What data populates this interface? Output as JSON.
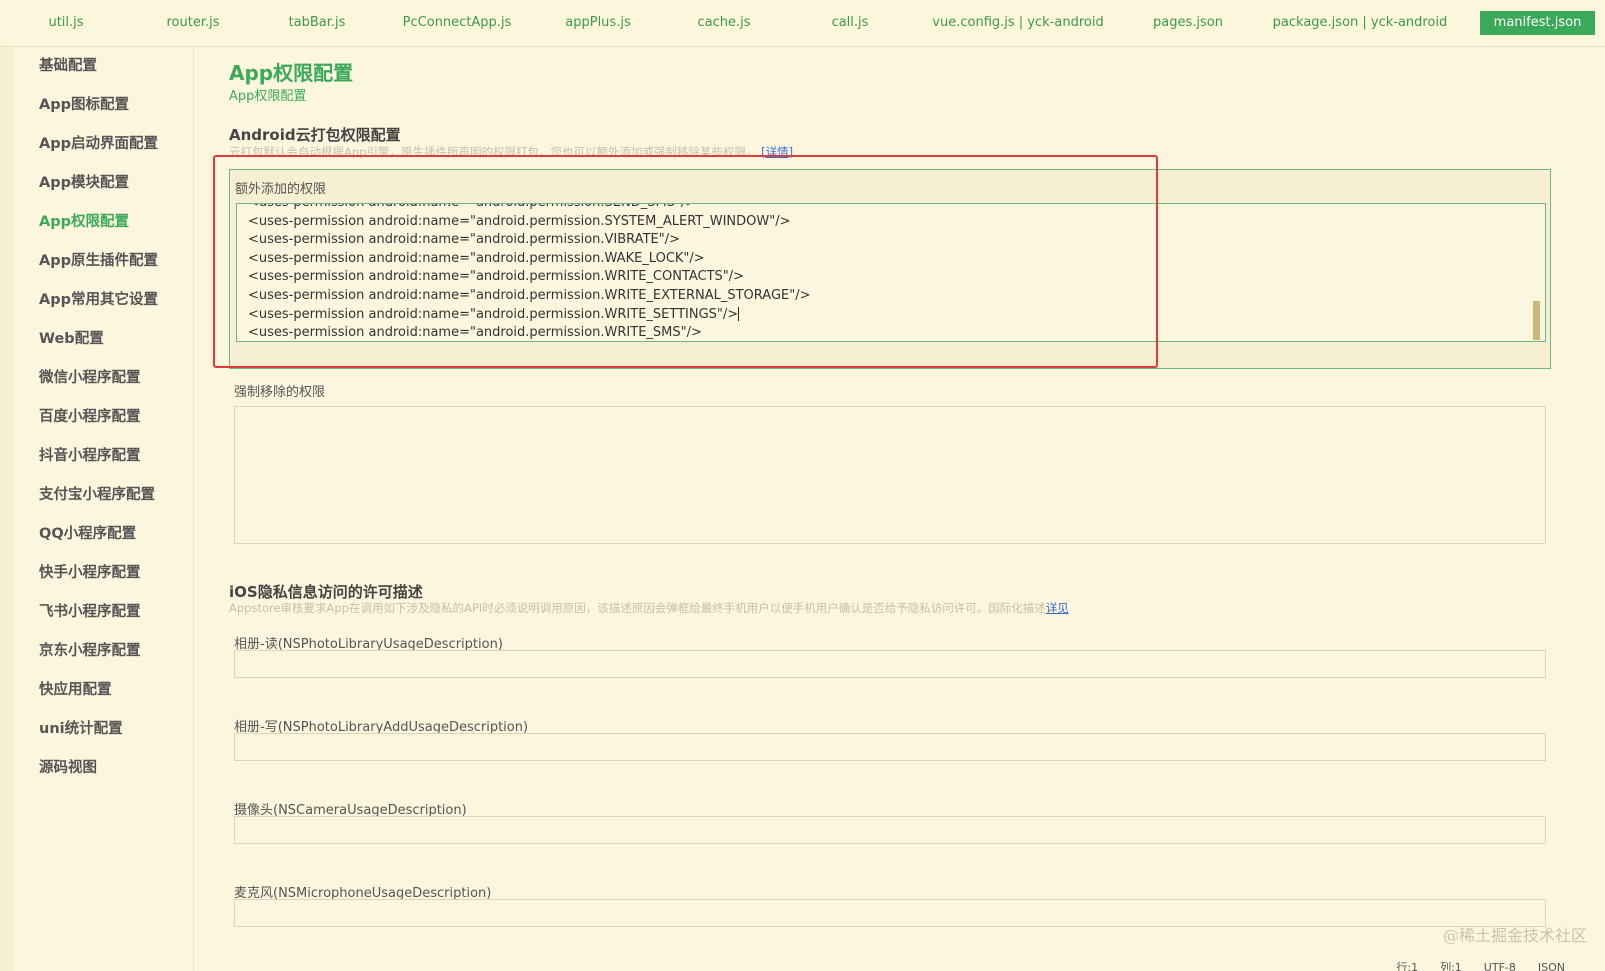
{
  "tabs": [
    {
      "label": "util.js",
      "active": false
    },
    {
      "label": "router.js",
      "active": false
    },
    {
      "label": "tabBar.js",
      "active": false
    },
    {
      "label": "PcConnectApp.js",
      "active": false
    },
    {
      "label": "appPlus.js",
      "active": false
    },
    {
      "label": "cache.js",
      "active": false
    },
    {
      "label": "call.js",
      "active": false
    },
    {
      "label": "vue.config.js | yck-android",
      "active": false
    },
    {
      "label": "pages.json",
      "active": false
    },
    {
      "label": "package.json | yck-android",
      "active": false
    },
    {
      "label": "manifest.json",
      "active": true
    }
  ],
  "sidebar": {
    "items": [
      {
        "label": "基础配置"
      },
      {
        "label": "App图标配置"
      },
      {
        "label": "App启动界面配置"
      },
      {
        "label": "App模块配置"
      },
      {
        "label": "App权限配置",
        "active": true
      },
      {
        "label": "App原生插件配置"
      },
      {
        "label": "App常用其它设置"
      },
      {
        "label": "Web配置"
      },
      {
        "label": "微信小程序配置"
      },
      {
        "label": "百度小程序配置"
      },
      {
        "label": "抖音小程序配置"
      },
      {
        "label": "支付宝小程序配置"
      },
      {
        "label": "QQ小程序配置"
      },
      {
        "label": "快手小程序配置"
      },
      {
        "label": "飞书小程序配置"
      },
      {
        "label": "京东小程序配置"
      },
      {
        "label": "快应用配置"
      },
      {
        "label": "uni统计配置"
      },
      {
        "label": "源码视图"
      }
    ]
  },
  "main": {
    "title": "App权限配置",
    "subtitle": "App权限配置",
    "android": {
      "title": "Android云打包权限配置",
      "desc": "云打包默认会自动根据App引擎，原生插件所声明的权限打包，您也可以额外添加或强制移除某些权限。",
      "desc_link": "[详情]",
      "extra_label": "额外添加的权限",
      "extra_lines": [
        "<uses-permission android:name=\"android.permission.SEND_SMS\"/>",
        "<uses-permission android:name=\"android.permission.SYSTEM_ALERT_WINDOW\"/>",
        "<uses-permission android:name=\"android.permission.VIBRATE\"/>",
        "<uses-permission android:name=\"android.permission.WAKE_LOCK\"/>",
        "<uses-permission android:name=\"android.permission.WRITE_CONTACTS\"/>",
        "<uses-permission android:name=\"android.permission.WRITE_EXTERNAL_STORAGE\"/>",
        "<uses-permission android:name=\"android.permission.WRITE_SETTINGS\"/>",
        "<uses-permission android:name=\"android.permission.WRITE_SMS\"/>"
      ],
      "remove_label": "强制移除的权限",
      "remove_value": ""
    },
    "ios": {
      "title": "iOS隐私信息访问的许可描述",
      "desc": "Appstore审核要求App在调用如下涉及隐私的API时必须说明调用原因，该描述原因会弹框给最终手机用户以便手机用户确认是否给予隐私访问许可。国际化描述",
      "desc_link": "详见",
      "fields": [
        {
          "label": "相册-读(NSPhotoLibraryUsageDescription)",
          "value": ""
        },
        {
          "label": "相册-写(NSPhotoLibraryAddUsageDescription)",
          "value": ""
        },
        {
          "label": "摄像头(NSCameraUsageDescription)",
          "value": ""
        },
        {
          "label": "麦克风(NSMicrophoneUsageDescription)",
          "value": ""
        }
      ]
    }
  },
  "statusbar": {
    "line": "行:1",
    "col": "列:1",
    "encoding": "UTF-8",
    "language": "JSON"
  },
  "watermark": "@稀土掘金技术社区",
  "colors": {
    "accent": "#3aaa5a",
    "background": "#fdf6de",
    "highlight": "#e23a3a",
    "link": "#2e6fd8"
  }
}
